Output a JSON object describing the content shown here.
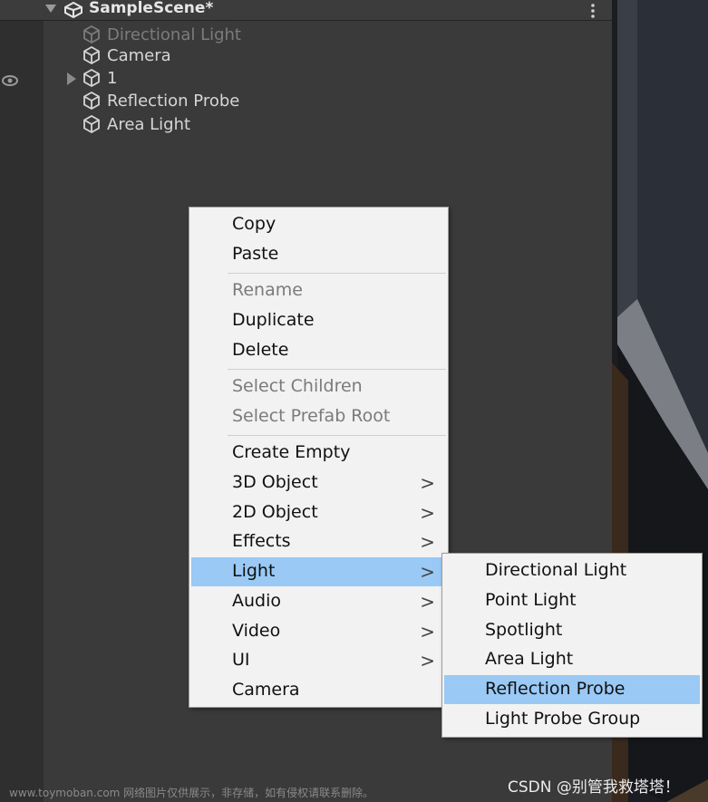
{
  "scene": {
    "title": "SampleScene*"
  },
  "hierarchy": [
    {
      "label": "Directional Light",
      "dim": true
    },
    {
      "label": "Camera",
      "dim": false
    },
    {
      "label": "1",
      "dim": false
    },
    {
      "label": "Reflection Probe",
      "dim": false
    },
    {
      "label": "Area Light",
      "dim": false
    }
  ],
  "context_menu": {
    "copy": "Copy",
    "paste": "Paste",
    "rename": "Rename",
    "duplicate": "Duplicate",
    "delete": "Delete",
    "select_children": "Select Children",
    "select_prefab_root": "Select Prefab Root",
    "create_empty": "Create Empty",
    "object_3d": "3D Object",
    "object_2d": "2D Object",
    "effects": "Effects",
    "light": "Light",
    "audio": "Audio",
    "video": "Video",
    "ui": "UI",
    "camera": "Camera"
  },
  "submenu_chevron": ">",
  "light_submenu": {
    "directional_light": "Directional Light",
    "point_light": "Point Light",
    "spotlight": "Spotlight",
    "area_light": "Area Light",
    "reflection_probe": "Reflection Probe",
    "light_probe_group": "Light Probe Group"
  },
  "footer": {
    "watermark": "www.toymoban.com 网络图片仅供展示，非存储，如有侵权请联系删除。",
    "credit": "CSDN @别管我救塔塔！"
  },
  "colors": {
    "highlight": "#99c9f4",
    "menu_bg": "#f2f2f2",
    "panel_bg": "#3a3a3a"
  }
}
